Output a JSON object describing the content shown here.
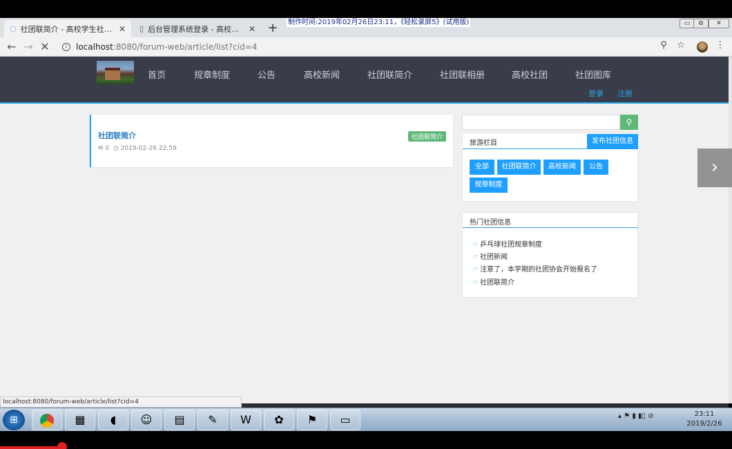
{
  "recorder": {
    "watermark": "制作时间:2019年02月26日23:11，《轻松录屏5》(试用版)"
  },
  "browser": {
    "tabs": [
      {
        "title": "社团联简介 - 高校学生社团管理系",
        "active": true
      },
      {
        "title": "后台管理系统登录 - 高校学生社团",
        "active": false
      }
    ],
    "new_tab_label": "+",
    "tab_close_label": "✕",
    "url_host": "localhost",
    "url_path": ":8080/forum-web/article/list?cid=4",
    "window_controls": {
      "minimize": "▭",
      "restore": "⧉",
      "close": "✕"
    }
  },
  "site": {
    "nav": [
      "首页",
      "规章制度",
      "公告",
      "高校新闻",
      "社团联简介",
      "社团联相册",
      "高校社团",
      "社团图库"
    ],
    "login": "登录",
    "register": "注册"
  },
  "article": {
    "title": "社团联简介",
    "comments": "0",
    "date": "2019-02-26 22:59",
    "category_badge": "社团联简介"
  },
  "sidebar": {
    "search_placeholder": "",
    "section_title": "旅游栏目",
    "publish_button": "发布社团信息",
    "categories": [
      "全部",
      "社团联简介",
      "高校新闻",
      "公告",
      "规章制度"
    ],
    "hot_title": "热门社团信息",
    "hot_items": [
      "乒乓球社团规章制度",
      "社团新闻",
      "注意了，本学期的社团协会开始报名了",
      "社团联简介"
    ]
  },
  "status_url": "localhost:8080/forum-web/article/list?cid=4",
  "taskbar": {
    "time": "23:11",
    "date": "2019/2/26"
  },
  "colors": {
    "header_bg": "#393d49",
    "accent_blue": "#1e9fff",
    "accent_green": "#5fb878"
  }
}
